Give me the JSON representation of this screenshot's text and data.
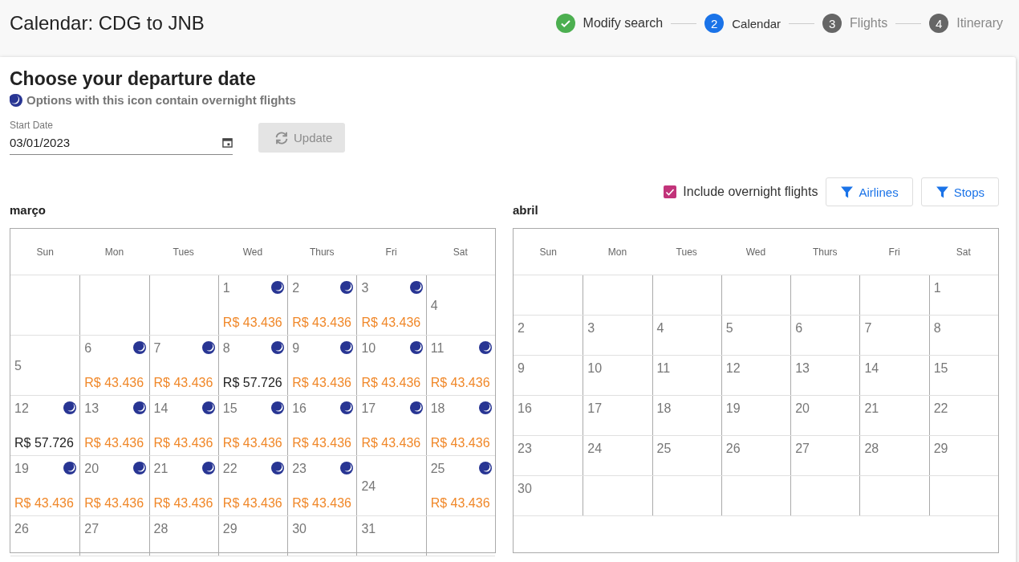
{
  "page_title": "Calendar: CDG to JNB",
  "steps": [
    {
      "label": "Modify search",
      "completed": true,
      "selected": false
    },
    {
      "number": "2",
      "label": "Calendar",
      "completed": false,
      "selected": true
    },
    {
      "number": "3",
      "label": "Flights",
      "completed": false,
      "selected": false
    },
    {
      "number": "4",
      "label": "Itinerary",
      "completed": false,
      "selected": false
    }
  ],
  "heading": "Choose your departure date",
  "legend": "Options with this icon contain overnight flights",
  "start_date": {
    "label": "Start Date",
    "value": "03/01/2023"
  },
  "update_button": {
    "label": "Update",
    "disabled": true
  },
  "include_overnight": {
    "label": "Include overnight flights",
    "checked": true
  },
  "filters": [
    "Airlines",
    "Stops"
  ],
  "months": [
    {
      "name": "março",
      "weekdays": [
        "Sun",
        "Mon",
        "Tues",
        "Wed",
        "Thurs",
        "Fri",
        "Sat"
      ],
      "weeks": [
        [
          {
            "kind": "blank"
          },
          {
            "kind": "blank"
          },
          {
            "kind": "blank"
          },
          {
            "kind": "day",
            "day": "1",
            "overnight": true,
            "price": "R$ 43.436",
            "cheapest": true
          },
          {
            "kind": "day",
            "day": "2",
            "overnight": true,
            "price": "R$ 43.436",
            "cheapest": true
          },
          {
            "kind": "day",
            "day": "3",
            "overnight": true,
            "price": "R$ 43.436",
            "cheapest": true
          },
          {
            "kind": "day",
            "day": "4",
            "overnight": false
          }
        ],
        [
          {
            "kind": "day",
            "day": "5",
            "overnight": false
          },
          {
            "kind": "day",
            "day": "6",
            "overnight": true,
            "price": "R$ 43.436",
            "cheapest": true
          },
          {
            "kind": "day",
            "day": "7",
            "overnight": true,
            "price": "R$ 43.436",
            "cheapest": true
          },
          {
            "kind": "day",
            "day": "8",
            "overnight": true,
            "price": "R$ 57.726",
            "cheapest": false
          },
          {
            "kind": "day",
            "day": "9",
            "overnight": true,
            "price": "R$ 43.436",
            "cheapest": true
          },
          {
            "kind": "day",
            "day": "10",
            "overnight": true,
            "price": "R$ 43.436",
            "cheapest": true
          },
          {
            "kind": "day",
            "day": "11",
            "overnight": true,
            "price": "R$ 43.436",
            "cheapest": true
          }
        ],
        [
          {
            "kind": "day",
            "day": "12",
            "overnight": true,
            "price": "R$ 57.726",
            "cheapest": false
          },
          {
            "kind": "day",
            "day": "13",
            "overnight": true,
            "price": "R$ 43.436",
            "cheapest": true
          },
          {
            "kind": "day",
            "day": "14",
            "overnight": true,
            "price": "R$ 43.436",
            "cheapest": true
          },
          {
            "kind": "day",
            "day": "15",
            "overnight": true,
            "price": "R$ 43.436",
            "cheapest": true
          },
          {
            "kind": "day",
            "day": "16",
            "overnight": true,
            "price": "R$ 43.436",
            "cheapest": true
          },
          {
            "kind": "day",
            "day": "17",
            "overnight": true,
            "price": "R$ 43.436",
            "cheapest": true
          },
          {
            "kind": "day",
            "day": "18",
            "overnight": true,
            "price": "R$ 43.436",
            "cheapest": true
          }
        ],
        [
          {
            "kind": "day",
            "day": "19",
            "overnight": true,
            "price": "R$ 43.436",
            "cheapest": true
          },
          {
            "kind": "day",
            "day": "20",
            "overnight": true,
            "price": "R$ 43.436",
            "cheapest": true
          },
          {
            "kind": "day",
            "day": "21",
            "overnight": true,
            "price": "R$ 43.436",
            "cheapest": true
          },
          {
            "kind": "day",
            "day": "22",
            "overnight": true,
            "price": "R$ 43.436",
            "cheapest": true
          },
          {
            "kind": "day",
            "day": "23",
            "overnight": true,
            "price": "R$ 43.436",
            "cheapest": true
          },
          {
            "kind": "day",
            "day": "24",
            "overnight": false
          },
          {
            "kind": "day",
            "day": "25",
            "overnight": true,
            "price": "R$ 43.436",
            "cheapest": true
          }
        ],
        [
          {
            "kind": "day",
            "day": "26",
            "overnight": false
          },
          {
            "kind": "day",
            "day": "27",
            "overnight": false
          },
          {
            "kind": "day",
            "day": "28",
            "overnight": false
          },
          {
            "kind": "day",
            "day": "29",
            "overnight": false
          },
          {
            "kind": "day",
            "day": "30",
            "overnight": false
          },
          {
            "kind": "day",
            "day": "31",
            "overnight": false
          },
          {
            "kind": "blank"
          }
        ]
      ]
    },
    {
      "name": "abril",
      "weekdays": [
        "Sun",
        "Mon",
        "Tues",
        "Wed",
        "Thurs",
        "Fri",
        "Sat"
      ],
      "weeks": [
        [
          {
            "kind": "blank"
          },
          {
            "kind": "blank"
          },
          {
            "kind": "blank"
          },
          {
            "kind": "blank"
          },
          {
            "kind": "blank"
          },
          {
            "kind": "blank"
          },
          {
            "kind": "day",
            "day": "1",
            "overnight": false
          }
        ],
        [
          {
            "kind": "day",
            "day": "2",
            "overnight": false
          },
          {
            "kind": "day",
            "day": "3",
            "overnight": false
          },
          {
            "kind": "day",
            "day": "4",
            "overnight": false
          },
          {
            "kind": "day",
            "day": "5",
            "overnight": false
          },
          {
            "kind": "day",
            "day": "6",
            "overnight": false
          },
          {
            "kind": "day",
            "day": "7",
            "overnight": false
          },
          {
            "kind": "day",
            "day": "8",
            "overnight": false
          }
        ],
        [
          {
            "kind": "day",
            "day": "9",
            "overnight": false
          },
          {
            "kind": "day",
            "day": "10",
            "overnight": false
          },
          {
            "kind": "day",
            "day": "11",
            "overnight": false
          },
          {
            "kind": "day",
            "day": "12",
            "overnight": false
          },
          {
            "kind": "day",
            "day": "13",
            "overnight": false
          },
          {
            "kind": "day",
            "day": "14",
            "overnight": false
          },
          {
            "kind": "day",
            "day": "15",
            "overnight": false
          }
        ],
        [
          {
            "kind": "day",
            "day": "16",
            "overnight": false
          },
          {
            "kind": "day",
            "day": "17",
            "overnight": false
          },
          {
            "kind": "day",
            "day": "18",
            "overnight": false
          },
          {
            "kind": "day",
            "day": "19",
            "overnight": false
          },
          {
            "kind": "day",
            "day": "20",
            "overnight": false
          },
          {
            "kind": "day",
            "day": "21",
            "overnight": false
          },
          {
            "kind": "day",
            "day": "22",
            "overnight": false
          }
        ],
        [
          {
            "kind": "day",
            "day": "23",
            "overnight": false
          },
          {
            "kind": "day",
            "day": "24",
            "overnight": false
          },
          {
            "kind": "day",
            "day": "25",
            "overnight": false
          },
          {
            "kind": "day",
            "day": "26",
            "overnight": false
          },
          {
            "kind": "day",
            "day": "27",
            "overnight": false
          },
          {
            "kind": "day",
            "day": "28",
            "overnight": false
          },
          {
            "kind": "day",
            "day": "29",
            "overnight": false
          }
        ],
        [
          {
            "kind": "day",
            "day": "30",
            "overnight": false
          },
          {
            "kind": "blank"
          },
          {
            "kind": "blank"
          },
          {
            "kind": "blank"
          },
          {
            "kind": "blank"
          },
          {
            "kind": "blank"
          },
          {
            "kind": "blank"
          }
        ]
      ]
    }
  ]
}
